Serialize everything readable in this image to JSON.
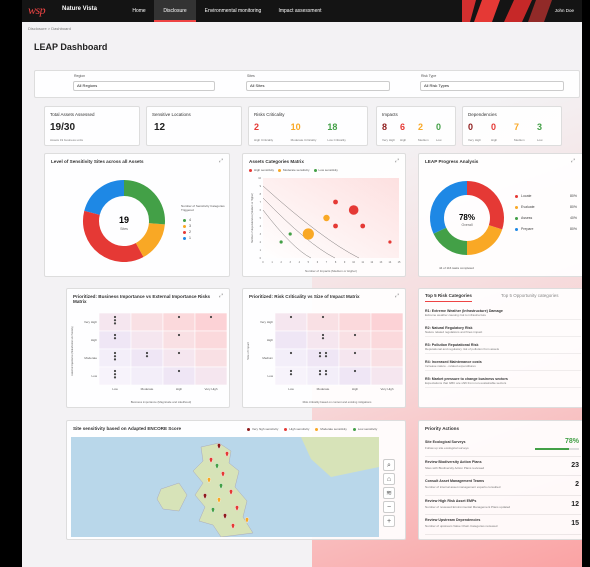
{
  "header": {
    "logo": "wsp",
    "app_name": "Nature Vista",
    "user": "John Doe",
    "nav": [
      "Home",
      "Disclosure",
      "Environmental monitoring",
      "Impact assessment"
    ]
  },
  "breadcrumb": "Disclosure > Dashboard",
  "page_title": "LEAP Dashboard",
  "filters": [
    {
      "label": "Region",
      "value": "All Regions"
    },
    {
      "label": "Sites",
      "value": "All Sites"
    },
    {
      "label": "Risk Type",
      "value": "All Risk Types"
    }
  ],
  "kpis": {
    "assessed": {
      "title": "Total Assets Assessed",
      "value": "19/30",
      "sub": "Assets 19 business units"
    },
    "sensitive": {
      "title": "Sensitive Locations",
      "value": "12"
    },
    "risks": {
      "title": "Risks Criticality",
      "items": [
        {
          "value": "2",
          "label": "High Criticality",
          "color": "#e53935"
        },
        {
          "value": "10",
          "label": "Moderate Criticality",
          "color": "#f9a825"
        },
        {
          "value": "18",
          "label": "Low Criticality",
          "color": "#43a047"
        }
      ]
    },
    "impacts": {
      "title": "Impacts",
      "items": [
        {
          "value": "8",
          "label": "Very High",
          "color": "#8e1b1b"
        },
        {
          "value": "6",
          "label": "High",
          "color": "#e53935"
        },
        {
          "value": "2",
          "label": "Medium",
          "color": "#f9a825"
        },
        {
          "value": "0",
          "label": "Low",
          "color": "#43a047"
        }
      ]
    },
    "dependencies": {
      "title": "Dependencies",
      "items": [
        {
          "value": "0",
          "label": "Very High",
          "color": "#8e1b1b"
        },
        {
          "value": "0",
          "label": "High",
          "color": "#e53935"
        },
        {
          "value": "7",
          "label": "Medium",
          "color": "#f9a825"
        },
        {
          "value": "3",
          "label": "Low",
          "color": "#43a047"
        }
      ]
    }
  },
  "sensitivity": {
    "title": "Level of Sensitivity Sites across all Assets",
    "center_value": "19",
    "center_label": "Sites",
    "legend_title": "Number of Sensitivity Categories Triggered",
    "legend": [
      {
        "label": "4",
        "color": "#43a047"
      },
      {
        "label": "3",
        "color": "#f9a825"
      },
      {
        "label": "2",
        "color": "#e53935"
      },
      {
        "label": "1",
        "color": "#1e88e5"
      }
    ]
  },
  "matrix": {
    "title": "Assets Categories Matrix",
    "legend": [
      {
        "label": "High sensitivity",
        "color": "#e53935"
      },
      {
        "label": "Moderate sensitivity",
        "color": "#f9a825"
      },
      {
        "label": "Low sensitivity",
        "color": "#43a047"
      }
    ],
    "ylabel": "Number of dependencies (Medium or Higher)",
    "xlabel": "Number of Impacts (Medium or Higher)"
  },
  "progress": {
    "title": "LEAP Progress Analysis",
    "center_value": "78%",
    "center_label": "Overall",
    "footer": "44 of 116 tasks completed",
    "legend": [
      {
        "label": "Locate",
        "value": "80%",
        "color": "#e53935"
      },
      {
        "label": "Evaluate",
        "value": "80%",
        "color": "#f9a825"
      },
      {
        "label": "Assess",
        "value": "40%",
        "color": "#43a047"
      },
      {
        "label": "Prepare",
        "value": "80%",
        "color": "#1e88e5"
      }
    ]
  },
  "biz": {
    "title": "Prioritized: Business Importance vs External Importance Risks Matrix",
    "ylabel": "External Importance (Stakeholder and Society)",
    "xlabel": "Business importance (Magnitude and Likelihood)",
    "rows": [
      "Very High",
      "High",
      "Moderate",
      "Low"
    ],
    "cols": [
      "Low",
      "Moderate",
      "High",
      "Very High"
    ]
  },
  "crit": {
    "title": "Prioritized: Risk Criticality vs Size of Impact Matrix",
    "ylabel": "Size of Impact",
    "xlabel": "Risk criticality based on context and existing mitigations",
    "rows": [
      "Very High",
      "High",
      "Medium",
      "Low"
    ],
    "cols": [
      "Low",
      "Moderate",
      "High",
      "Very High"
    ]
  },
  "tabs": {
    "active": "Top 5 Risk Categories",
    "inactive": "Top 5 Opportunity categories",
    "items": [
      {
        "title": "R1: Extreme Weather (Infrastructure) Damage",
        "desc": "Extreme weather causing risk to infrastructure"
      },
      {
        "title": "R2: Natural Regulatory Risk",
        "desc": "Nature related regulations and fines impact"
      },
      {
        "title": "R3: Pollution Reputational Risk",
        "desc": "Reputational and regulatory risk of pollution from assets"
      },
      {
        "title": "R4: Increased Maintenance costs",
        "desc": "Increase nature - related expenditures"
      },
      {
        "title": "R5: Market pressure to change business sectors",
        "desc": "Expectations that GBC are shift from non-sustainable sectors"
      }
    ]
  },
  "map": {
    "title": "Site sensitivity based on Adapted ENCORE Score",
    "legend": [
      {
        "label": "Very high sensitivity",
        "color": "#8e1b1b"
      },
      {
        "label": "High sensitivity",
        "color": "#e53935"
      },
      {
        "label": "Moderate sensitivity",
        "color": "#f9a825"
      },
      {
        "label": "Low sensitivity",
        "color": "#43a047"
      }
    ],
    "controls": [
      "search-icon",
      "home-icon",
      "layers-icon",
      "zoom-out-icon",
      "zoom-in-icon"
    ]
  },
  "actions": {
    "title": "Priority Actions",
    "items": [
      {
        "title": "Site Ecological Surveys",
        "desc": "Follow up site ecological surveys",
        "value": "78%"
      },
      {
        "title": "Review Biodiversity Action Plans",
        "desc": "Sites with Biodiversity Action Plans reviewed",
        "value": "23"
      },
      {
        "title": "Consult Asset Management Teams",
        "desc": "Number of internal asset management experts consulted",
        "value": "2"
      },
      {
        "title": "Review High Risk Asset EMPs",
        "desc": "Number of reviewed Environmental Management Plans updated",
        "value": "12"
      },
      {
        "title": "Review Upstream Dependencies",
        "desc": "Number of upstream Value Chain Categories reviewed",
        "value": "15"
      }
    ]
  },
  "chart_data": [
    {
      "type": "pie",
      "title": "Level of Sensitivity Sites across all Assets",
      "categories": [
        "4",
        "3",
        "2",
        "1"
      ],
      "values": [
        5,
        3,
        7,
        4
      ]
    },
    {
      "type": "scatter",
      "title": "Assets Categories Matrix",
      "xlabel": "Number of Impacts (Medium or Higher)",
      "ylabel": "Number of dependencies (Medium or Higher)",
      "xlim": [
        0,
        15
      ],
      "ylim": [
        0,
        10
      ],
      "x": [
        8,
        10,
        7,
        8,
        5,
        3,
        2,
        11,
        14
      ],
      "y": [
        7,
        6,
        5,
        4,
        3,
        3,
        2,
        4,
        2
      ],
      "size": [
        3,
        6,
        4,
        3,
        7,
        2,
        2,
        3,
        2
      ],
      "colors": [
        "#e53935",
        "#e53935",
        "#f9a825",
        "#e53935",
        "#f9a825",
        "#43a047",
        "#43a047",
        "#e53935",
        "#e53935"
      ]
    },
    {
      "type": "pie",
      "title": "LEAP Progress Analysis",
      "categories": [
        "Locate",
        "Evaluate",
        "Assess",
        "Prepare"
      ],
      "values": [
        30,
        20,
        18,
        32
      ]
    }
  ]
}
